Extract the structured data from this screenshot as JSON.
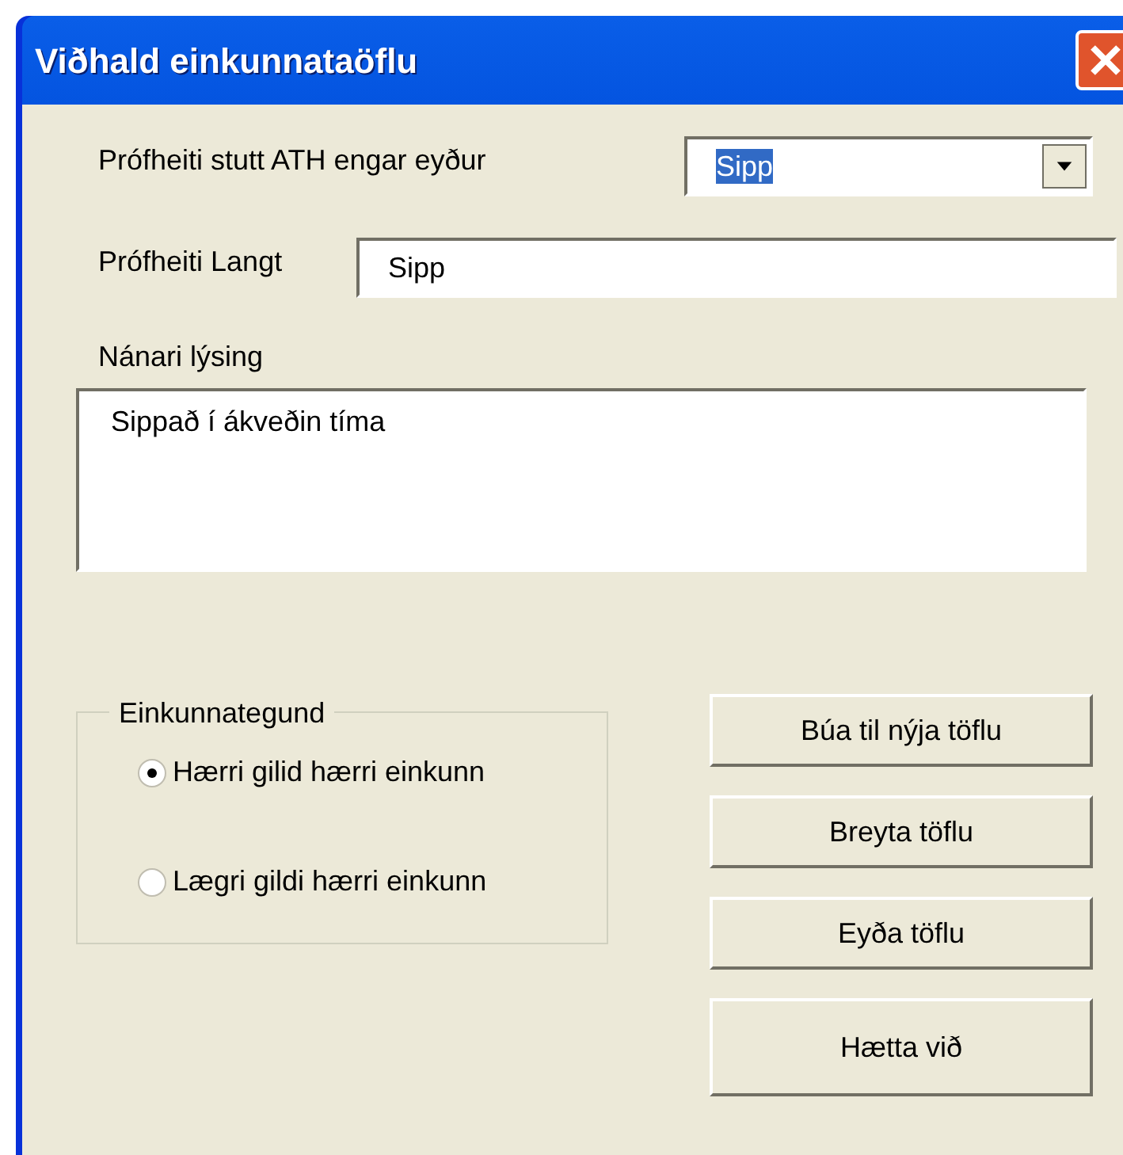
{
  "window": {
    "title": "Viðhald einkunnataöflu"
  },
  "short_name": {
    "label": "Prófheiti stutt ATH engar eyður",
    "value": "Sipp"
  },
  "long_name": {
    "label": "Prófheiti Langt",
    "value": "Sipp"
  },
  "description": {
    "label": "Nánari lýsing",
    "value": "Sippað í ákveðin tíma"
  },
  "grade_type": {
    "title": "Einkunnategund",
    "options": [
      {
        "label": "Hærri gilid hærri einkunn",
        "selected": true
      },
      {
        "label": "Lægri gildi hærri einkunn",
        "selected": false
      }
    ]
  },
  "buttons": [
    {
      "label": "Búa til nýja töflu"
    },
    {
      "label": "Breyta töflu"
    },
    {
      "label": "Eyða töflu"
    },
    {
      "label": "Hætta við"
    }
  ]
}
